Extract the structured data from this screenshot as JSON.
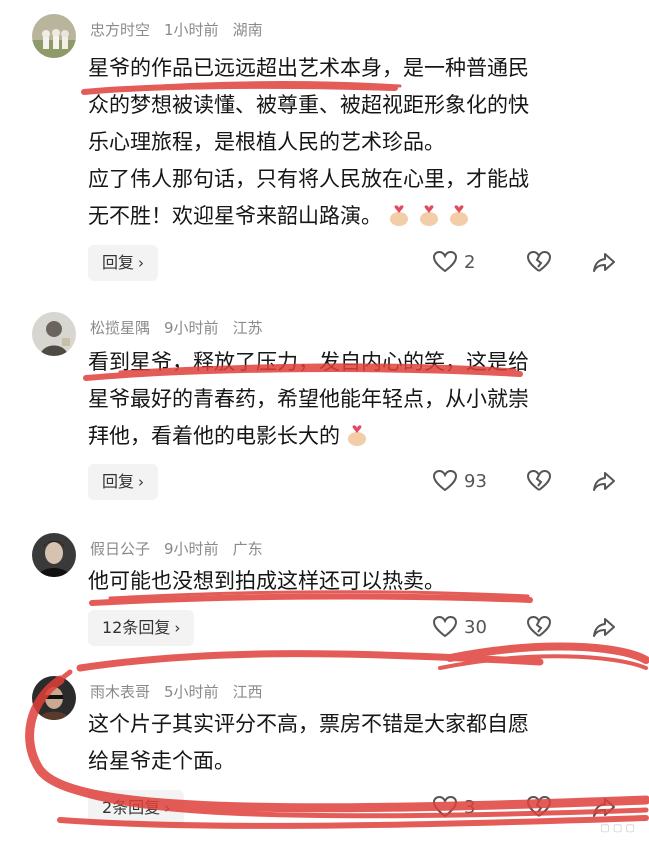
{
  "comments": [
    {
      "user": "忠方时空",
      "time": "1小时前",
      "location": "湖南",
      "lines": [
        "星爷的作品已远远超出艺术本身，是一种普通民",
        "众的梦想被读懂、被尊重、被超视距形象化的快",
        "乐心理旅程，是根植人民的艺术珍品。",
        "应了伟人那句话，只有将人民放在心里，才能战",
        "无不胜！欢迎星爷来韶山路演。"
      ],
      "reply_label": "回复",
      "likes": "2"
    },
    {
      "user": "松揽星隅",
      "time": "9小时前",
      "location": "江苏",
      "lines": [
        "看到星爷，释放了压力，发自内心的笑，这是给",
        "星爷最好的青春药，希望他能年轻点，从小就崇",
        "拜他，看着他的电影长大的"
      ],
      "reply_label": "回复",
      "likes": "93"
    },
    {
      "user": "假日公子",
      "time": "9小时前",
      "location": "广东",
      "lines": [
        "他可能也没想到拍成这样还可以热卖。"
      ],
      "reply_label": "12条回复",
      "likes": "30"
    },
    {
      "user": "雨木表哥",
      "time": "5小时前",
      "location": "江西",
      "lines": [
        "这个片子其实评分不高，票房不错是大家都自愿",
        "给星爷走个面。"
      ],
      "reply_label": "2条回复",
      "likes": "3"
    }
  ],
  "icons": {
    "like": "heart-outline-icon",
    "dislike": "broken-heart-icon",
    "share": "share-arrow-icon",
    "emoji": "finger-heart-emoji"
  },
  "colors": {
    "annotation": "#e0403a",
    "meta": "#8a8a8a"
  }
}
